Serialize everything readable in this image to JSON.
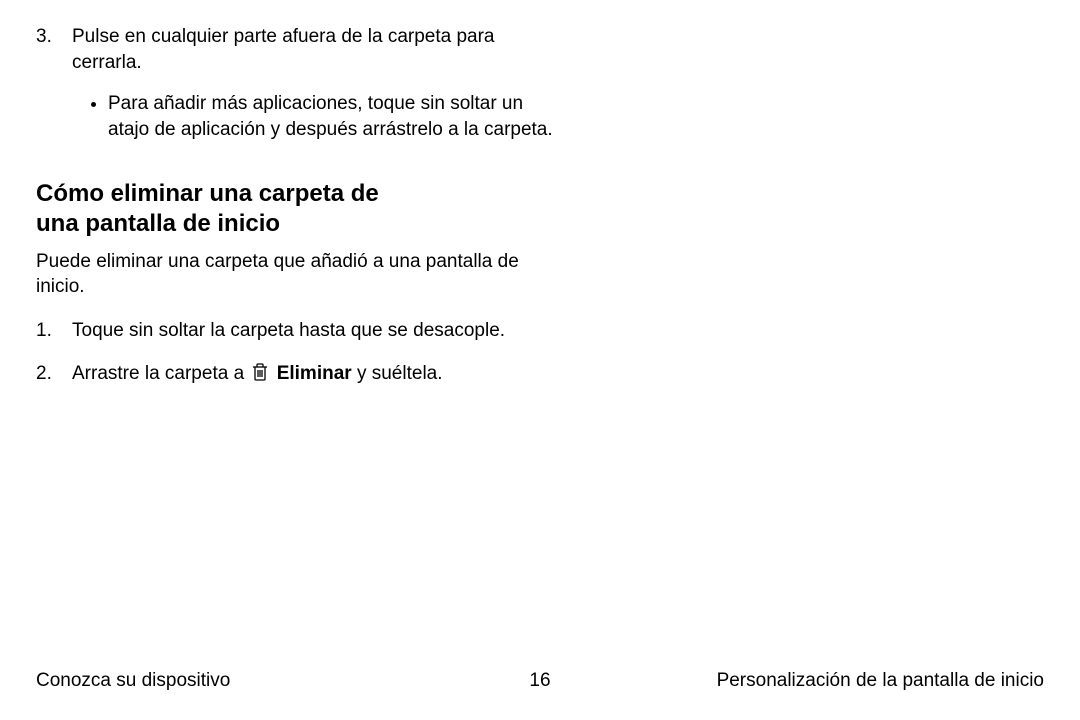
{
  "continued_list": {
    "item3": {
      "text": "Pulse en cualquier parte afuera de la carpeta para cerrarla.",
      "sub_bullet": "Para añadir más aplicaciones, toque sin soltar un atajo de aplicación y después arrástrelo a la carpeta."
    }
  },
  "section": {
    "heading_line1": "Cómo eliminar una carpeta de",
    "heading_line2": "una pantalla de inicio",
    "intro": "Puede eliminar una carpeta que añadió a una pantalla de inicio.",
    "steps": {
      "s1": "Toque sin soltar la carpeta hasta que se desacople.",
      "s2_prefix": "Arrastre la carpeta a ",
      "s2_bold": "Eliminar",
      "s2_suffix": " y suéltela.",
      "trash_icon_name": "trash-icon"
    }
  },
  "footer": {
    "left": "Conozca su dispositivo",
    "page_number": "16",
    "right": "Personalización de la pantalla de inicio"
  }
}
